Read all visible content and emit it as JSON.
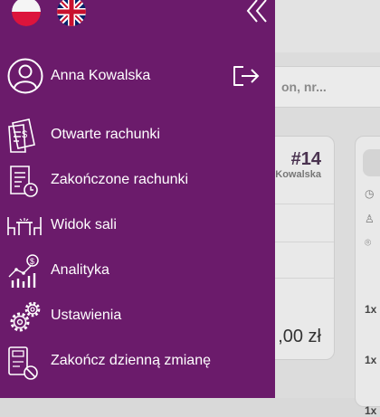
{
  "background": {
    "search_placeholder": "on, nr...",
    "order_card": {
      "number": "#14",
      "name": "Kowalska",
      "total": ",00 zł"
    },
    "card_qty": [
      "1x",
      "1x",
      "1x"
    ]
  },
  "drawer": {
    "languages": [
      {
        "code": "pl",
        "icon": "poland-flag-icon"
      },
      {
        "code": "en",
        "icon": "uk-flag-icon"
      }
    ],
    "user": {
      "name": "Anna Kowalska"
    },
    "menu": [
      {
        "label": "Otwarte rachunki",
        "icon": "open-bills-icon"
      },
      {
        "label": "Zakończone rachunki",
        "icon": "closed-bills-icon"
      },
      {
        "label": "Widok sali",
        "icon": "dining-room-icon"
      },
      {
        "label": "Analityka",
        "icon": "analytics-icon"
      },
      {
        "label": "Ustawienia",
        "icon": "settings-icon"
      },
      {
        "label": "Zakończ dzienną zmianę",
        "icon": "end-shift-icon"
      }
    ],
    "colors": {
      "drawer_bg": "#6b1b6b",
      "text": "#ffffff"
    }
  }
}
